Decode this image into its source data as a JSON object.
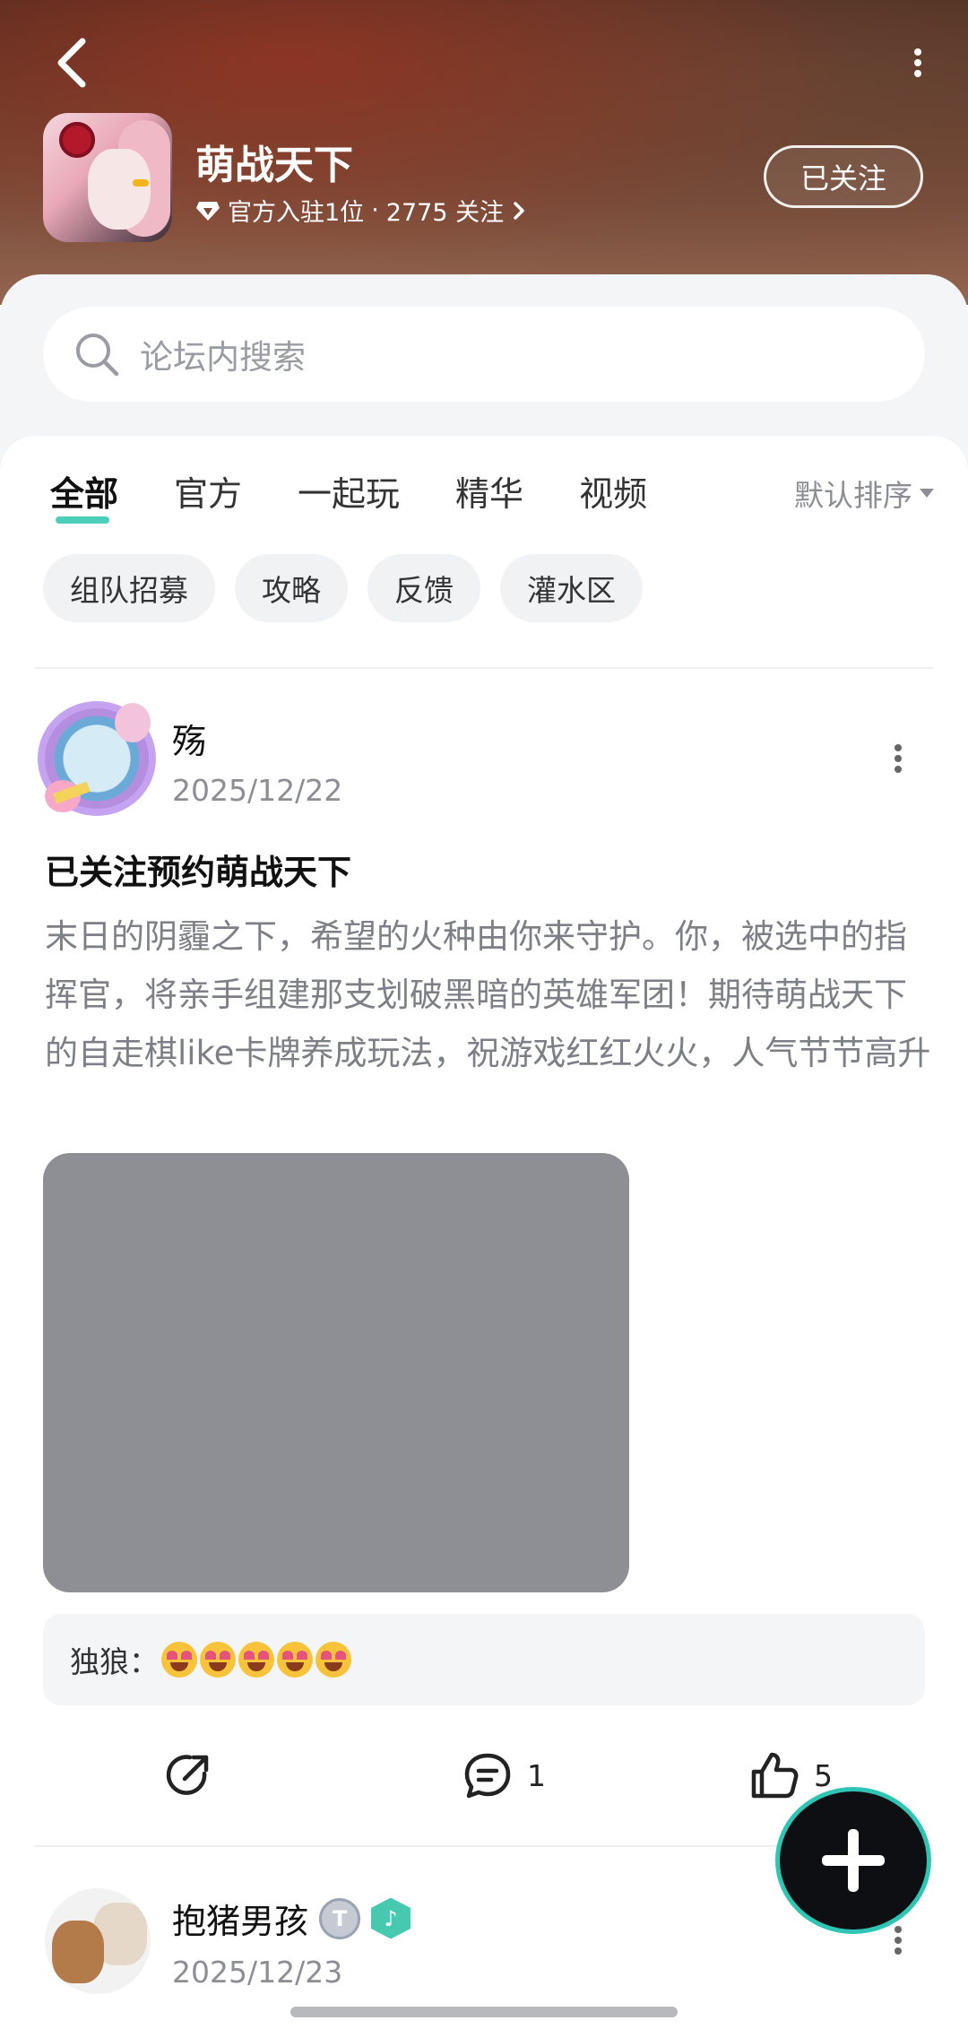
{
  "header": {
    "forum_name": "萌战天下",
    "official_count": "官方入驻1位",
    "separator": "·",
    "followers": "2775 关注",
    "follow_button": "已关注"
  },
  "search": {
    "placeholder": "论坛内搜索"
  },
  "tabs": [
    {
      "label": "全部",
      "active": true
    },
    {
      "label": "官方"
    },
    {
      "label": "一起玩"
    },
    {
      "label": "精华"
    },
    {
      "label": "视频"
    }
  ],
  "sort": {
    "label": "默认排序"
  },
  "chips": [
    "组队招募",
    "攻略",
    "反馈",
    "灌水区"
  ],
  "posts": [
    {
      "author": "殇",
      "date": "2025/12/22",
      "title": "已关注预约萌战天下",
      "body": "末日的阴霾之下，希望的火种由你来守护。你，被选中的指挥官，将亲手组建那支划破黑暗的英雄军团！期待萌战天下的自走棋like卡牌养成玩法，祝游戏红红火火，人气节节高升",
      "comment_preview": {
        "commenter": "独狼：",
        "emoji_count": 5
      },
      "share_label": "",
      "comment_count": "1",
      "like_count": "5"
    },
    {
      "author": "抱猪男孩",
      "date": "2025/12/23",
      "level_badge": "T",
      "music_badge": "♪"
    }
  ],
  "colors": {
    "accent": "#2ec5ae",
    "image_placeholder": "#8e8f94",
    "muted_text": "#8c8e94"
  }
}
